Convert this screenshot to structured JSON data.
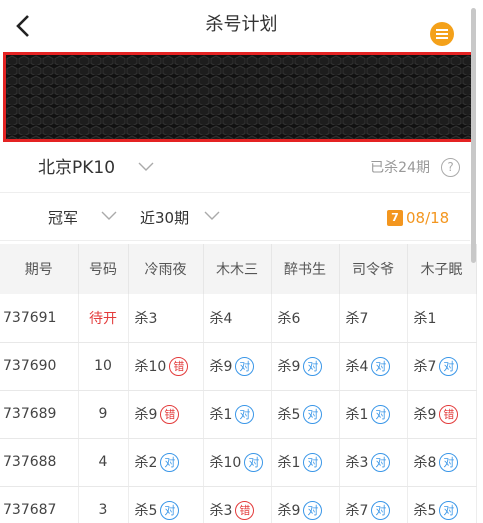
{
  "header": {
    "title": "杀号计划",
    "back_icon": "chevron-left-icon",
    "menu_icon": "list-menu-icon",
    "menu_color": "#f4a11a"
  },
  "banner": {
    "pattern": "dark-hexagon-texture",
    "highlight_color": "#e42323"
  },
  "lottery": {
    "name": "北京PK10",
    "killed_text": "已杀24期",
    "help_symbol": "?"
  },
  "filters": {
    "position": "冠军",
    "range": "近30期",
    "calendar_text": "7",
    "date": "08/18",
    "accent": "#f3961f"
  },
  "table": {
    "headers": [
      "期号",
      "号码",
      "冷雨夜",
      "木木三",
      "醉书生",
      "司令爷",
      "木子眠"
    ],
    "rows": [
      {
        "issue": "737691",
        "code": "待开",
        "pending": true,
        "kills": [
          {
            "label": "杀3",
            "result": ""
          },
          {
            "label": "杀4",
            "result": ""
          },
          {
            "label": "杀6",
            "result": ""
          },
          {
            "label": "杀7",
            "result": ""
          },
          {
            "label": "杀1",
            "result": ""
          }
        ]
      },
      {
        "issue": "737690",
        "code": "10",
        "pending": false,
        "kills": [
          {
            "label": "杀10",
            "result": "错"
          },
          {
            "label": "杀9",
            "result": "对"
          },
          {
            "label": "杀9",
            "result": "对"
          },
          {
            "label": "杀4",
            "result": "对"
          },
          {
            "label": "杀7",
            "result": "对"
          }
        ]
      },
      {
        "issue": "737689",
        "code": "9",
        "pending": false,
        "kills": [
          {
            "label": "杀9",
            "result": "错"
          },
          {
            "label": "杀1",
            "result": "对"
          },
          {
            "label": "杀5",
            "result": "对"
          },
          {
            "label": "杀1",
            "result": "对"
          },
          {
            "label": "杀9",
            "result": "错"
          }
        ]
      },
      {
        "issue": "737688",
        "code": "4",
        "pending": false,
        "kills": [
          {
            "label": "杀2",
            "result": "对"
          },
          {
            "label": "杀10",
            "result": "对"
          },
          {
            "label": "杀1",
            "result": "对"
          },
          {
            "label": "杀3",
            "result": "对"
          },
          {
            "label": "杀8",
            "result": "对"
          }
        ]
      },
      {
        "issue": "737687",
        "code": "3",
        "pending": false,
        "kills": [
          {
            "label": "杀5",
            "result": "对"
          },
          {
            "label": "杀3",
            "result": "错"
          },
          {
            "label": "杀9",
            "result": "对"
          },
          {
            "label": "杀7",
            "result": "对"
          },
          {
            "label": "杀5",
            "result": "对"
          }
        ]
      }
    ]
  },
  "colors": {
    "ok": "#3b97e8",
    "error": "#e33c3c",
    "pending": "#e33c3c"
  }
}
